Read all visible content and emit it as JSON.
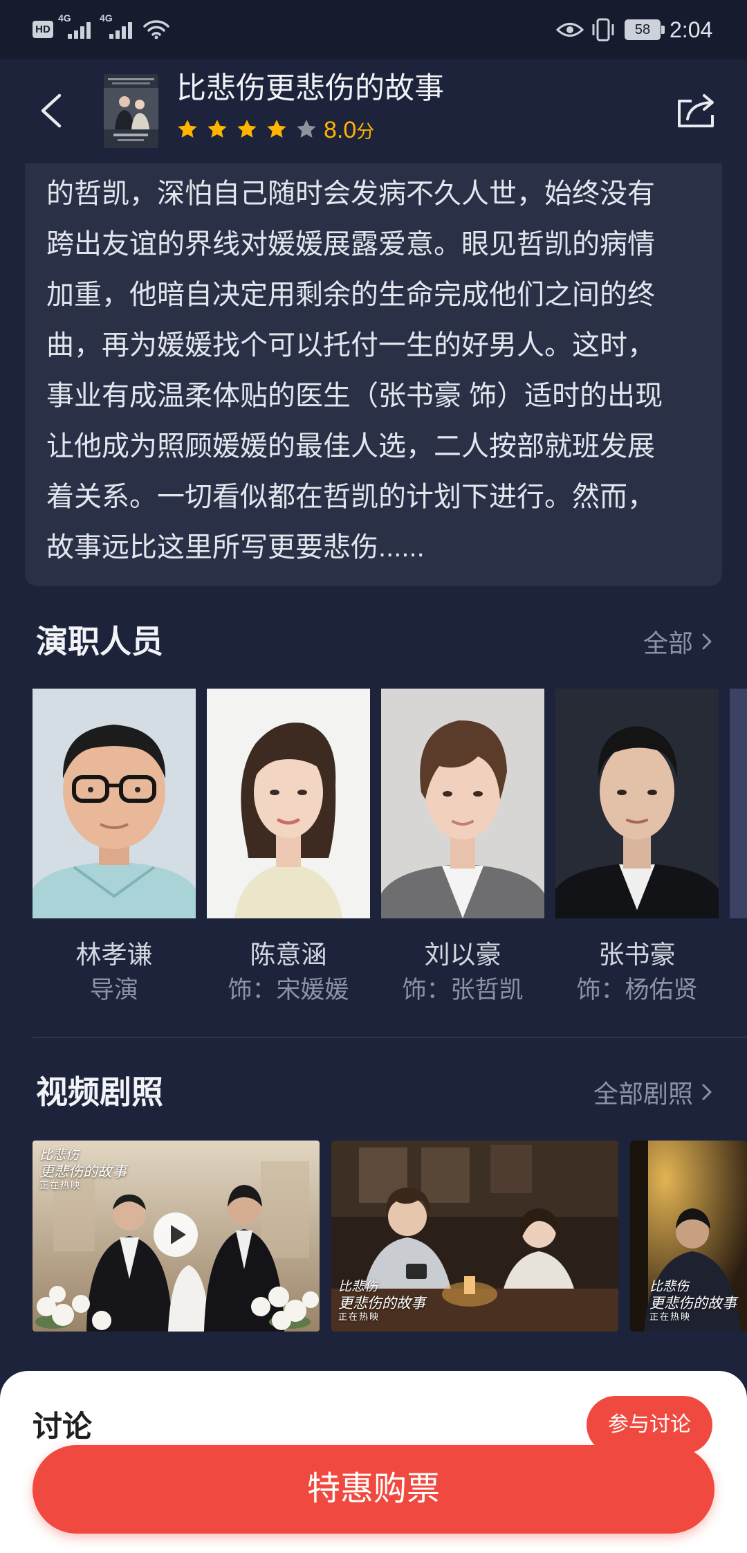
{
  "status_bar": {
    "hd": "HD",
    "net_1": "4G",
    "net_2": "4G",
    "battery": "58",
    "time": "2:04"
  },
  "header": {
    "title": "比悲伤更悲伤的故事",
    "stars_filled": 4,
    "stars_total": 5,
    "rating": "8.0",
    "rating_unit": "分",
    "icons": {
      "back": "chevron-left-icon",
      "share": "share-icon"
    }
  },
  "synopsis": {
    "lines": [
      "的哲凯，深怕自己随时会发病不久人世，始终没有",
      "跨出友谊的界线对媛媛展露爱意。眼见哲凯的病情",
      "加重，他暗自决定用剩余的生命完成他们之间的终",
      "曲，再为媛媛找个可以托付一生的好男人。这时，",
      "事业有成温柔体贴的医生（张书豪 饰）适时的出现",
      "让他成为照顾媛媛的最佳人选，二人按部就班发展",
      "着关系。一切看似都在哲凯的计划下进行。然而，",
      "故事远比这里所写更要悲伤......"
    ]
  },
  "cast": {
    "title": "演职人员",
    "more": "全部",
    "items": [
      {
        "name": "林孝谦",
        "role": "导演"
      },
      {
        "name": "陈意涵",
        "role": "饰：宋媛媛"
      },
      {
        "name": "刘以豪",
        "role": "饰：张哲凯"
      },
      {
        "name": "张书豪",
        "role": "饰：杨佑贤"
      }
    ]
  },
  "stills": {
    "title": "视频剧照",
    "more": "全部剧照",
    "items": [
      {
        "caption": [
          "比悲伤",
          "更悲伤的故事",
          "正在热映"
        ],
        "has_play_button": true
      },
      {
        "caption": [
          "比悲伤",
          "更悲伤的故事",
          "正在热映"
        ],
        "has_play_button": false
      },
      {
        "caption": [
          "比悲伤",
          "更悲伤的故事",
          "正在热映"
        ],
        "has_play_button": false
      }
    ]
  },
  "discussion": {
    "title": "讨论",
    "join_label": "参与讨论"
  },
  "buy": {
    "label": "特惠购票"
  },
  "colors": {
    "background": "#1c233a",
    "status_bar": "#161c2e",
    "card": "#2a3147",
    "accent": "#f04a40",
    "star": "#ffb400",
    "star_empty": "#8e939f"
  }
}
